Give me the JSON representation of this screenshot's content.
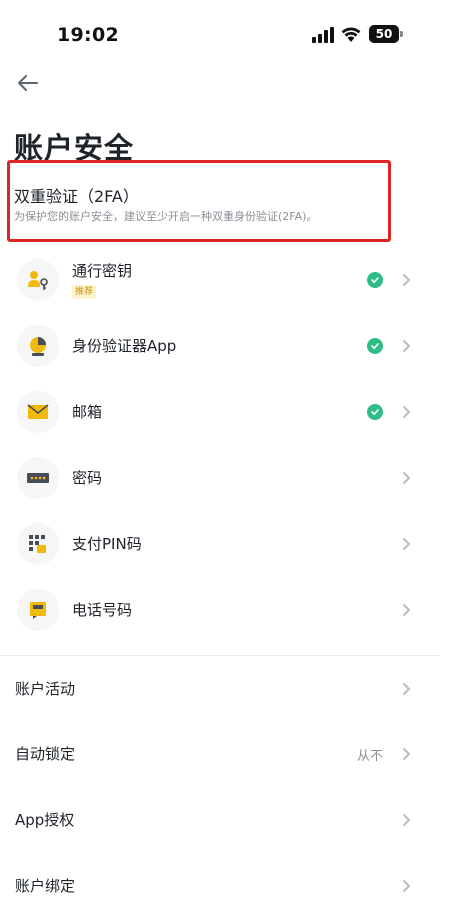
{
  "status_bar": {
    "time": "19:02",
    "battery": "50"
  },
  "header": {
    "back_icon": "arrow-left-icon",
    "title": "账户安全"
  },
  "twofa": {
    "title": "双重验证（2FA）",
    "description": "为保护您的账户安全，建议至少开启一种双重身份验证(2FA)。",
    "highlight_color": "#e02424"
  },
  "methods": [
    {
      "label": "通行密钥",
      "tag": "推荐",
      "icon": "passkey-icon",
      "enabled": true
    },
    {
      "label": "身份验证器App",
      "icon": "authenticator-app-icon",
      "enabled": true
    },
    {
      "label": "邮箱",
      "icon": "envelope-icon",
      "enabled": true
    },
    {
      "label": "密码",
      "icon": "password-icon",
      "enabled": false
    },
    {
      "label": "支付PIN码",
      "icon": "pin-keypad-icon",
      "enabled": false
    },
    {
      "label": "电话号码",
      "icon": "phone-icon",
      "enabled": false
    }
  ],
  "settings": [
    {
      "label": "账户活动"
    },
    {
      "label": "自动锁定",
      "value": "从不"
    },
    {
      "label": "App授权"
    },
    {
      "label": "账户绑定"
    }
  ],
  "colors": {
    "accent_yellow": "#f0b90b",
    "check_green": "#2ebd85",
    "text_primary": "#1e2329",
    "text_secondary": "#8a8f98"
  }
}
